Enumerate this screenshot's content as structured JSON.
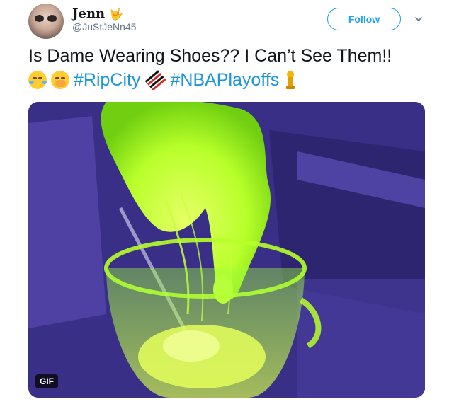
{
  "user": {
    "display_name": "Jenn",
    "display_emoji": "🤟",
    "handle": "@JuStJeNn45"
  },
  "follow_button": {
    "label": "Follow"
  },
  "tweet": {
    "text": "Is Dame Wearing Shoes?? I Can’t See Them!!",
    "hashtags": [
      "#RipCity",
      "#NBAPlayoffs"
    ]
  },
  "media": {
    "badge": "GIF"
  },
  "colors": {
    "accent": "#1da1f2",
    "hashtag": "#1b95e0",
    "text": "#14171a",
    "secondary_text": "#657786",
    "slime": "#b8ff2a"
  }
}
